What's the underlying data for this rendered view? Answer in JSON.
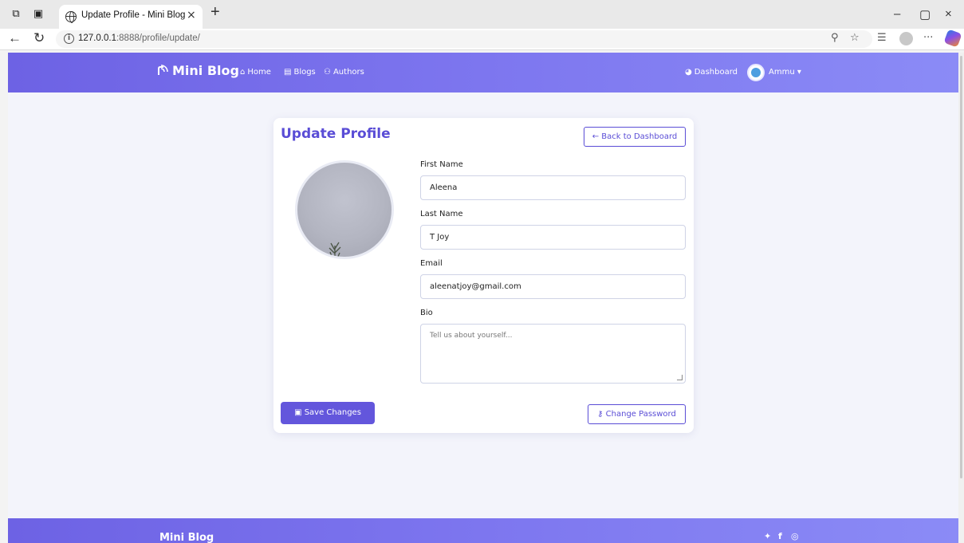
{
  "browser": {
    "tab_title": "Update Profile - Mini Blog",
    "tab_close": "×",
    "new_tab": "+",
    "url_host": "127.0.0.1",
    "url_rest": ":8888/profile/update/",
    "minimize": "–",
    "restore": "▢",
    "close": "×"
  },
  "navbar": {
    "brand": "Mini Blog",
    "links": [
      {
        "label": "Home",
        "icon": "home-icon"
      },
      {
        "label": "Blogs",
        "icon": "blogs-icon"
      },
      {
        "label": "Authors",
        "icon": "authors-icon"
      }
    ],
    "dashboard": {
      "label": "Dashboard",
      "icon": "dashboard-icon"
    },
    "user": "Ammu ▾"
  },
  "card": {
    "title": "Update Profile",
    "back_button": "← Back to Dashboard",
    "fields": {
      "first_name": {
        "label": "First Name",
        "value": "Aleena"
      },
      "last_name": {
        "label": "Last Name",
        "value": "T Joy"
      },
      "email": {
        "label": "Email",
        "value": "aleenatjoy@gmail.com"
      },
      "bio": {
        "label": "Bio",
        "placeholder": "Tell us about yourself..."
      }
    },
    "save_button": "Save Changes",
    "change_password_button": "Change Password"
  },
  "footer": {
    "brand": "Mini Blog",
    "social_icons": [
      "twitter-icon",
      "facebook-icon",
      "instagram-icon"
    ]
  },
  "colors": {
    "accent": "#5a4dd6",
    "navbar_start": "#6d62e4",
    "navbar_end": "#8b8bf6"
  }
}
